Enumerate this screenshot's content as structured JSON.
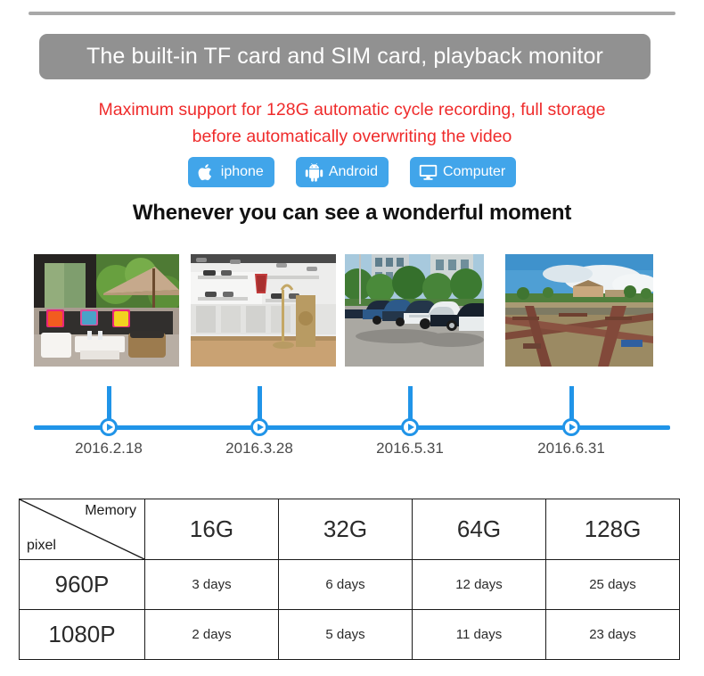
{
  "banner": {
    "title": "The built-in TF card and SIM card, playback monitor",
    "bg_color": "#919191",
    "text_color": "#ffffff"
  },
  "subtitle": {
    "line1": "Maximum support for 128G automatic cycle recording, full storage",
    "line2": "before automatically overwriting the video",
    "color": "#ef2b2b"
  },
  "badges": {
    "accent_color": "#41a5ea",
    "items": [
      {
        "label": "iphone",
        "icon": "apple-icon"
      },
      {
        "label": "Android",
        "icon": "android-icon"
      },
      {
        "label": "Computer",
        "icon": "monitor-icon"
      }
    ]
  },
  "section_heading": "Whenever you can see a wonderful moment",
  "photos": [
    {
      "caption": "outdoor-patio-lounge"
    },
    {
      "caption": "retail-store-interior"
    },
    {
      "caption": "parking-lot-cars"
    },
    {
      "caption": "waterfront-fish-farm"
    }
  ],
  "timeline": {
    "accent_color": "#2094e8",
    "nodes": [
      {
        "date": "2016.2.18"
      },
      {
        "date": "2016.3.28"
      },
      {
        "date": "2016.5.31"
      },
      {
        "date": "2016.6.31"
      }
    ]
  },
  "specs_table": {
    "corner": {
      "top_right": "Memory",
      "bottom_left": "pixel"
    },
    "capacities": [
      "16G",
      "32G",
      "64G",
      "128G"
    ],
    "rows": [
      {
        "resolution": "960P",
        "values": [
          "3 days",
          "6 days",
          "12 days",
          "25 days"
        ]
      },
      {
        "resolution": "1080P",
        "values": [
          "2 days",
          "5 days",
          "11 days",
          "23 days"
        ]
      }
    ]
  }
}
